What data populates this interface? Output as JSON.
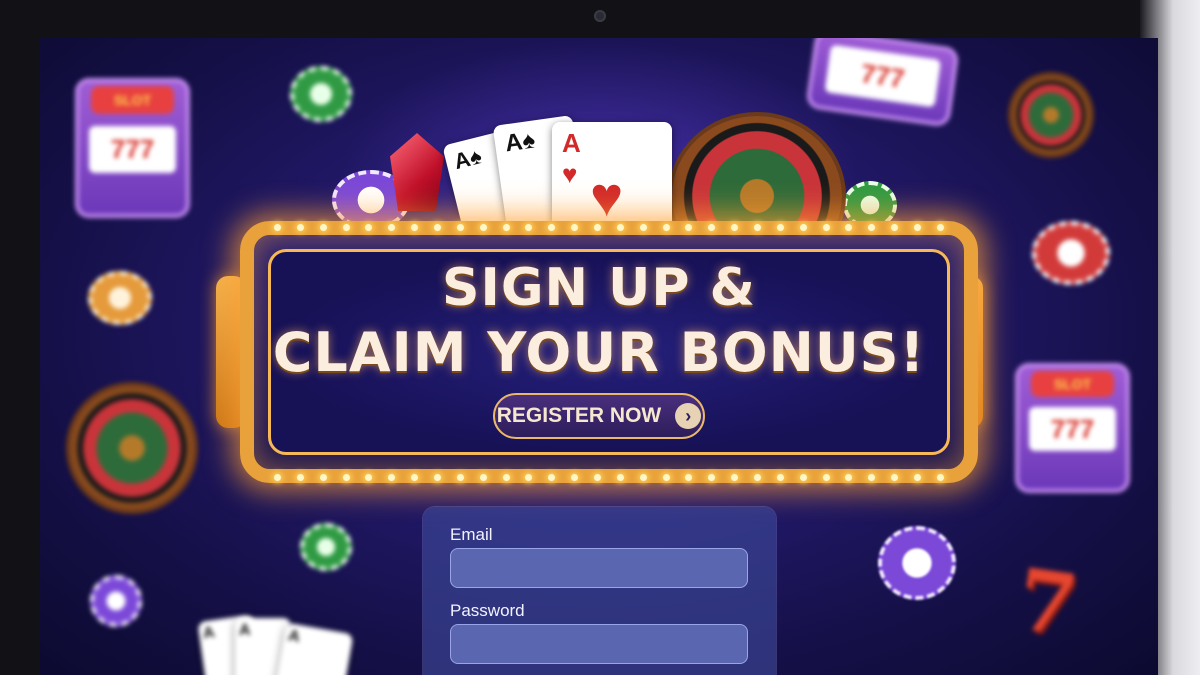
{
  "banner": {
    "headline_line1": "SIGN UP &",
    "headline_line2": "CLAIM YOUR BONUS!",
    "register_button_label": "REGISTER NOW",
    "register_arrow_glyph": "›"
  },
  "form": {
    "email_label": "Email",
    "email_value": "",
    "password_label": "Password",
    "password_value": ""
  },
  "decorations": {
    "slot_sign": "SLOT",
    "slot_reels": "777",
    "lucky_seven": "7",
    "card_ace": "A",
    "icons": [
      "slot-machine-icon",
      "roulette-wheel-icon",
      "poker-chip-icon",
      "playing-card-icon",
      "gem-icon",
      "lucky-seven-icon"
    ]
  },
  "colors": {
    "background": "#241a6e",
    "marquee_frame": "#e9a23b",
    "headline_text": "#fbeede",
    "form_panel": "#3c4696"
  }
}
